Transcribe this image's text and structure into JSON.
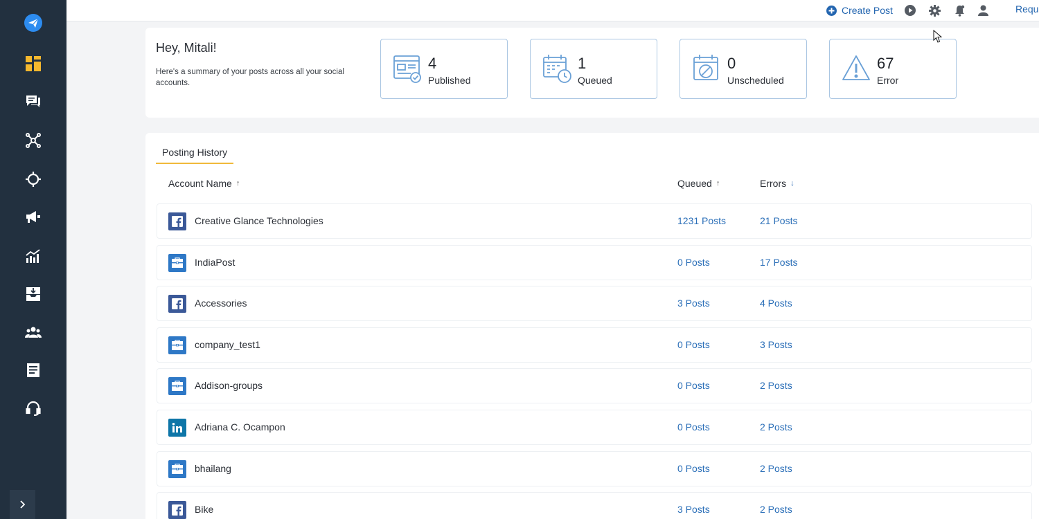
{
  "sidebar": {
    "items": [
      {
        "icon": "send-logo-icon"
      },
      {
        "icon": "dashboard-icon"
      },
      {
        "icon": "chat-icon"
      },
      {
        "icon": "network-icon"
      },
      {
        "icon": "target-icon"
      },
      {
        "icon": "megaphone-icon"
      },
      {
        "icon": "analytics-icon"
      },
      {
        "icon": "inbox-download-icon"
      },
      {
        "icon": "users-icon"
      },
      {
        "icon": "report-icon"
      },
      {
        "icon": "support-headset-icon"
      }
    ],
    "accent": "#f5b82e",
    "background": "#22303f"
  },
  "topbar": {
    "create_post": "Create Post",
    "request": "Requ"
  },
  "summary": {
    "greeting": "Hey, Mitali!",
    "subtext": "Here's a summary of your posts across all your social accounts.",
    "stats": [
      {
        "value": "4",
        "label": "Published",
        "icon": "published-icon"
      },
      {
        "value": "1",
        "label": "Queued",
        "icon": "queued-calendar-icon"
      },
      {
        "value": "0",
        "label": "Unscheduled",
        "icon": "unscheduled-calendar-icon"
      },
      {
        "value": "67",
        "label": "Error",
        "icon": "warning-icon"
      }
    ]
  },
  "history": {
    "tab": "Posting History",
    "columns": {
      "account": "Account Name",
      "account_arrow": "↑",
      "queued": "Queued",
      "queued_arrow": "↑",
      "errors": "Errors",
      "errors_arrow": "↓"
    },
    "rows": [
      {
        "name": "Creative Glance Technologies",
        "type": "facebook",
        "queued": "1231 Posts",
        "errors": "21 Posts"
      },
      {
        "name": "IndiaPost",
        "type": "business",
        "queued": "0 Posts",
        "errors": "17 Posts"
      },
      {
        "name": "Accessories",
        "type": "facebook",
        "queued": "3 Posts",
        "errors": "4 Posts"
      },
      {
        "name": "company_test1",
        "type": "business",
        "queued": "0 Posts",
        "errors": "3 Posts"
      },
      {
        "name": "Addison-groups",
        "type": "business",
        "queued": "0 Posts",
        "errors": "2 Posts"
      },
      {
        "name": "Adriana C. Ocampon",
        "type": "linkedin",
        "queued": "0 Posts",
        "errors": "2 Posts"
      },
      {
        "name": "bhailang",
        "type": "business",
        "queued": "0 Posts",
        "errors": "2 Posts"
      },
      {
        "name": "Bike",
        "type": "facebook",
        "queued": "3 Posts",
        "errors": "2 Posts"
      }
    ]
  },
  "colors": {
    "link": "#2b6fb8",
    "card_border": "#aac6e2",
    "tab_underline": "#f0b93a"
  }
}
